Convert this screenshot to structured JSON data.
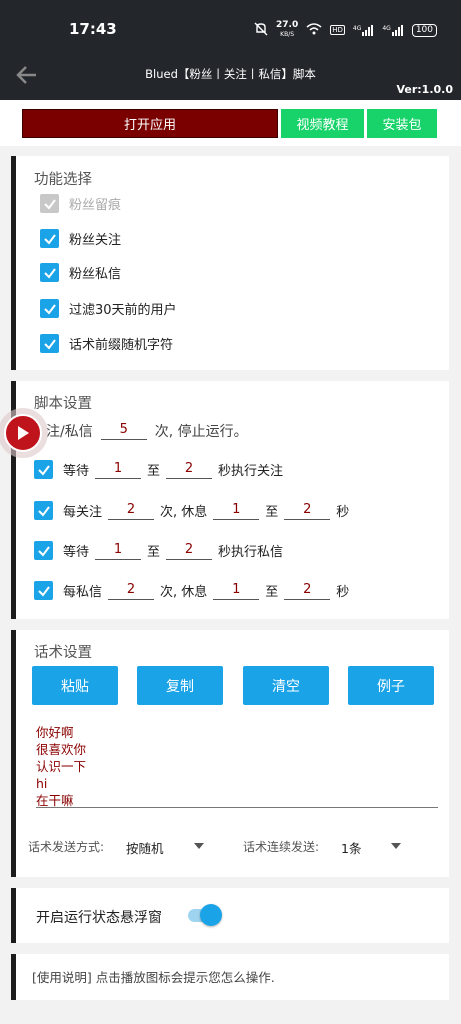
{
  "status": {
    "time": "17:43",
    "speed": "27.0",
    "speed_unit": "KB/S",
    "battery": "100",
    "hd": "HD",
    "net1": "4G",
    "net2": "4G"
  },
  "header": {
    "title": "Blued【粉丝丨关注丨私信】脚本",
    "version": "Ver:1.0.0"
  },
  "actions": {
    "open": "打开应用",
    "video": "视频教程",
    "install": "安装包"
  },
  "features": {
    "title": "功能选择",
    "items": [
      {
        "label": "粉丝留痕",
        "checked": true,
        "disabled": true
      },
      {
        "label": "粉丝关注",
        "checked": true
      },
      {
        "label": "粉丝私信",
        "checked": true
      },
      {
        "label": "过滤30天前的用户",
        "checked": true
      },
      {
        "label": "话术前缀随机字符",
        "checked": true
      }
    ]
  },
  "script": {
    "title": "脚本设置",
    "stop_prefix": "注/私信",
    "stop_count": "5",
    "stop_suffix": "次, 停止运行。",
    "row1": {
      "a": "等待",
      "v1": "1",
      "to": "至",
      "v2": "2",
      "b": "秒执行关注"
    },
    "row2": {
      "a": "每关注",
      "v1": "2",
      "b": "次, 休息",
      "v2": "1",
      "to": "至",
      "v3": "2",
      "c": "秒"
    },
    "row3": {
      "a": "等待",
      "v1": "1",
      "to": "至",
      "v2": "2",
      "b": "秒执行私信"
    },
    "row4": {
      "a": "每私信",
      "v1": "2",
      "b": "次, 休息",
      "v2": "1",
      "to": "至",
      "v3": "2",
      "c": "秒"
    }
  },
  "messages": {
    "title": "话术设置",
    "paste": "粘贴",
    "copy": "复制",
    "clear": "清空",
    "example": "例子",
    "lines": [
      "你好啊",
      "很喜欢你",
      "认识一下",
      "hi",
      "在干嘛"
    ],
    "mode_label": "话术发送方式:",
    "mode_value": "按随机",
    "cont_label": "话术连续发送:",
    "cont_value": "1条"
  },
  "floatwin": {
    "label": "开启运行状态悬浮窗",
    "enabled": true
  },
  "info": {
    "text": "[使用说明] 点击播放图标会提示您怎么操作."
  },
  "colors": {
    "accent": "#1ba3e8",
    "dark_red": "#7a0000",
    "green": "#17d36a",
    "header": "#23262b"
  }
}
